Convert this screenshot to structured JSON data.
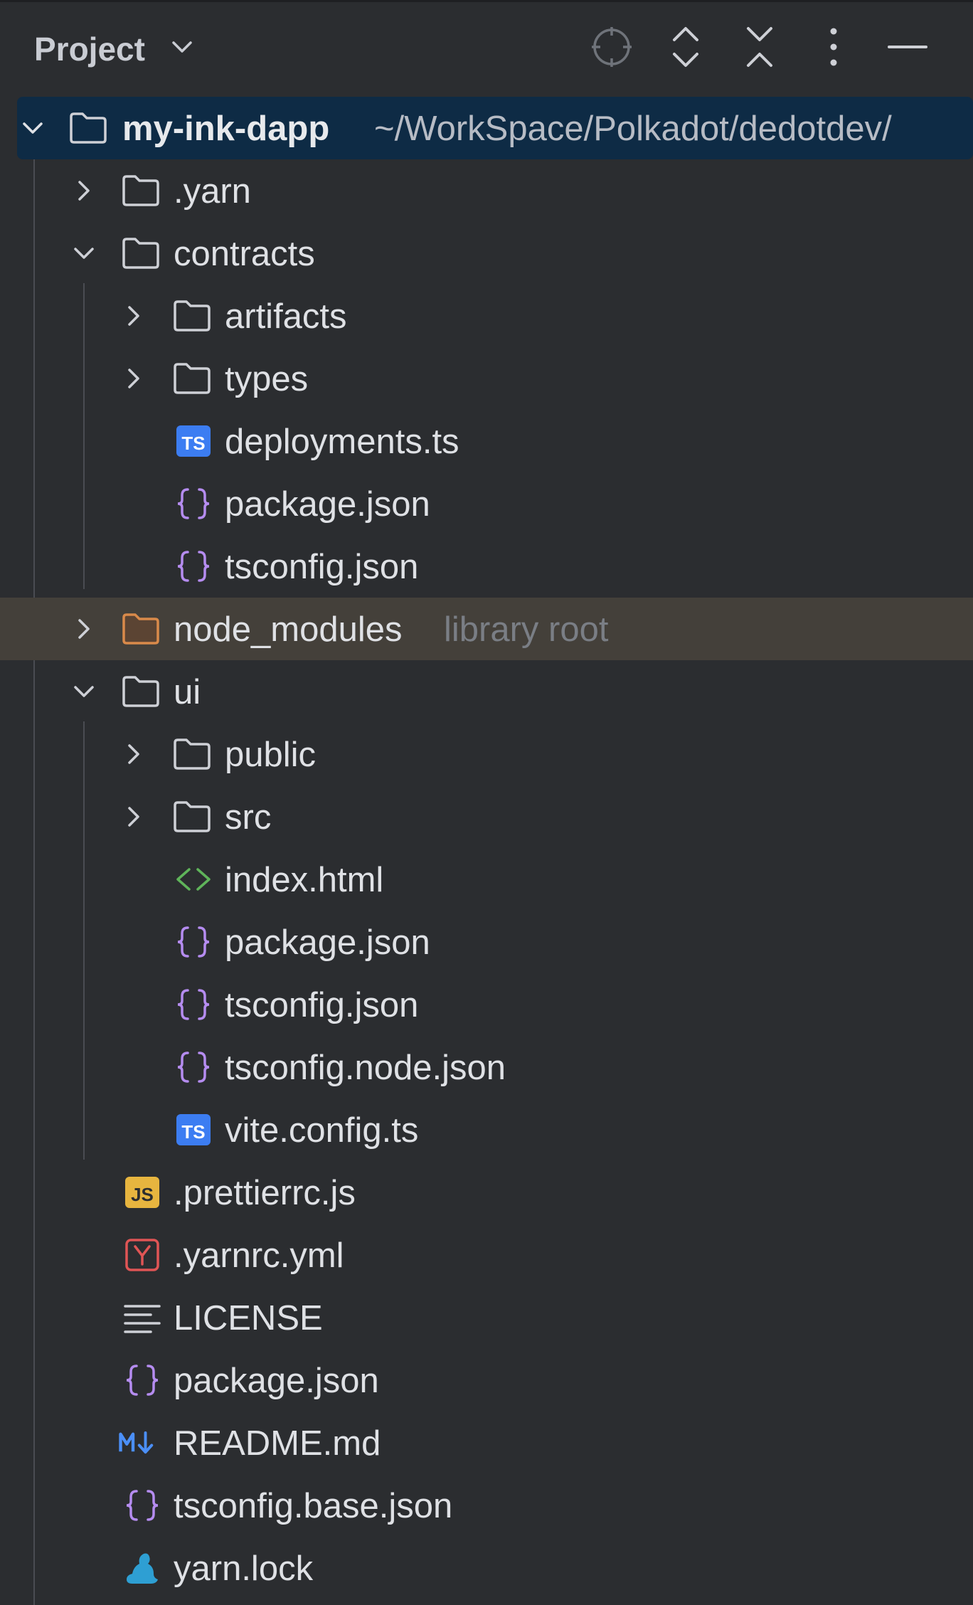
{
  "header": {
    "title": "Project",
    "buttons": [
      "locate-icon",
      "expand-all-icon",
      "collapse-all-icon",
      "more-options-icon",
      "minimize-icon"
    ]
  },
  "tree": {
    "root": {
      "name": "my-ink-dapp",
      "path": "~/WorkSpace/Polkadot/dedotdev/"
    },
    "yarn_dir": ".yarn",
    "contracts": {
      "name": "contracts",
      "artifacts": "artifacts",
      "types": "types",
      "deployments": "deployments.ts",
      "package": "package.json",
      "tsconfig": "tsconfig.json"
    },
    "node_modules": {
      "name": "node_modules",
      "hint": "library root"
    },
    "ui": {
      "name": "ui",
      "public": "public",
      "src": "src",
      "index": "index.html",
      "package": "package.json",
      "tsconfig": "tsconfig.json",
      "tsconfig_node": "tsconfig.node.json",
      "vite": "vite.config.ts"
    },
    "prettierrc": ".prettierrc.js",
    "yarnrc": ".yarnrc.yml",
    "license": "LICENSE",
    "package": "package.json",
    "readme": "README.md",
    "tsconfig_base": "tsconfig.base.json",
    "yarn_lock": "yarn.lock"
  },
  "colors": {
    "background": "#2b2d30",
    "selection": "#0e2b45",
    "library_highlight": "#44403a",
    "folder_icon": "#ced0d6",
    "library_folder_icon": "#d98a4a",
    "ts_badge": "#3c7df2",
    "json_icon": "#b58cf0",
    "html_icon": "#5fb45a",
    "js_badge": "#e7b53f",
    "yaml_icon": "#e05555",
    "markdown_icon": "#4b8ff7",
    "yarn_icon": "#2e9fd3"
  }
}
